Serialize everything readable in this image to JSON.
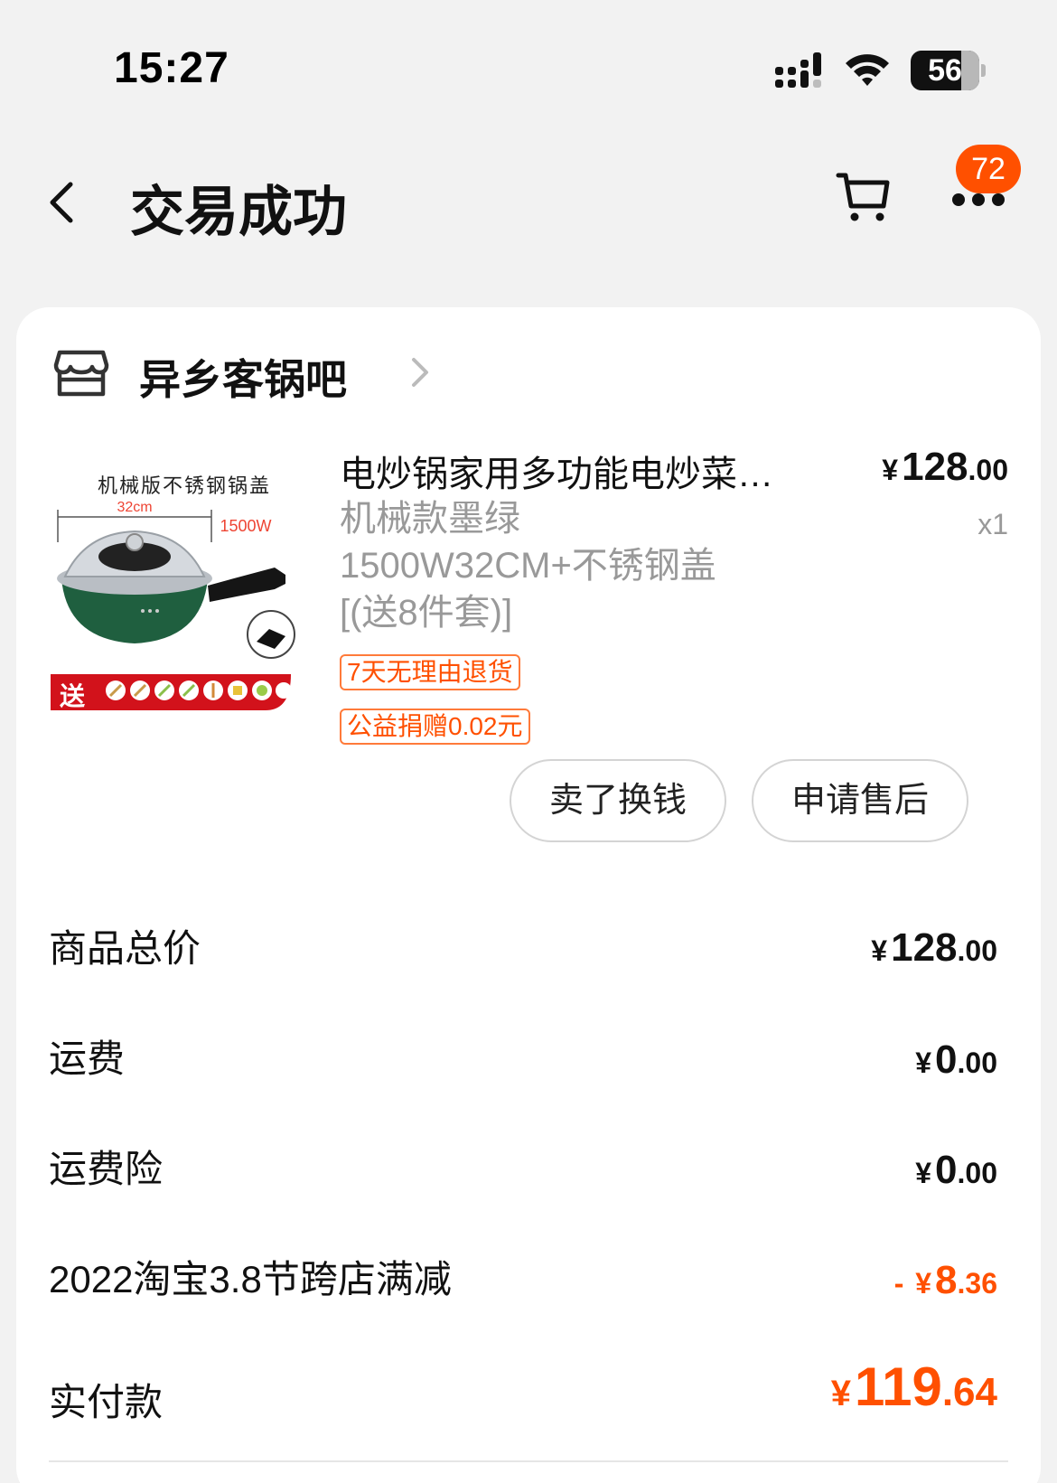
{
  "status_bar": {
    "time": "15:27",
    "battery": "56"
  },
  "nav": {
    "title": "交易成功",
    "more_badge": "72"
  },
  "shop": {
    "name": "异乡客锅吧"
  },
  "product": {
    "image_caption": "机械版不锈钢锅盖",
    "image_size_label": "32cm",
    "image_power_label": "1500W",
    "image_gift_label": "送",
    "title": "电炒锅家用多功能电炒菜…",
    "price": {
      "yen": "¥",
      "int": "128",
      "dec": ".00"
    },
    "quantity": "x1",
    "sku_lines": [
      "机械款墨绿",
      "1500W32CM+不锈钢盖",
      "[(送8件套)]"
    ],
    "tags": {
      "return": "7天无理由退货",
      "donation": "公益捐赠0.02元"
    },
    "buttons": {
      "sell": "卖了换钱",
      "aftersale": "申请售后"
    }
  },
  "summary": {
    "subtotal": {
      "label": "商品总价",
      "yen": "¥",
      "int": "128",
      "dec": ".00"
    },
    "shipping": {
      "label": "运费",
      "yen": "¥",
      "int": "0",
      "dec": ".00"
    },
    "insurance": {
      "label": "运费险",
      "yen": "¥",
      "int": "0",
      "dec": ".00"
    },
    "promo": {
      "label": "2022淘宝3.8节跨店满减",
      "sign": "- ",
      "yen": "¥",
      "int": "8",
      "dec": ".36"
    },
    "paid": {
      "label": "实付款",
      "yen": "¥",
      "int": "119",
      "dec": ".64"
    }
  },
  "colors": {
    "accent": "#ff5000",
    "background": "#f2f2f2",
    "card": "#ffffff",
    "muted_text": "#999999",
    "pan_green": "#1f5f3f"
  },
  "icons": [
    "signal-icon",
    "wifi-icon",
    "battery-icon",
    "back-arrow-icon",
    "cart-icon",
    "more-icon",
    "shop-icon",
    "chevron-right-icon"
  ]
}
